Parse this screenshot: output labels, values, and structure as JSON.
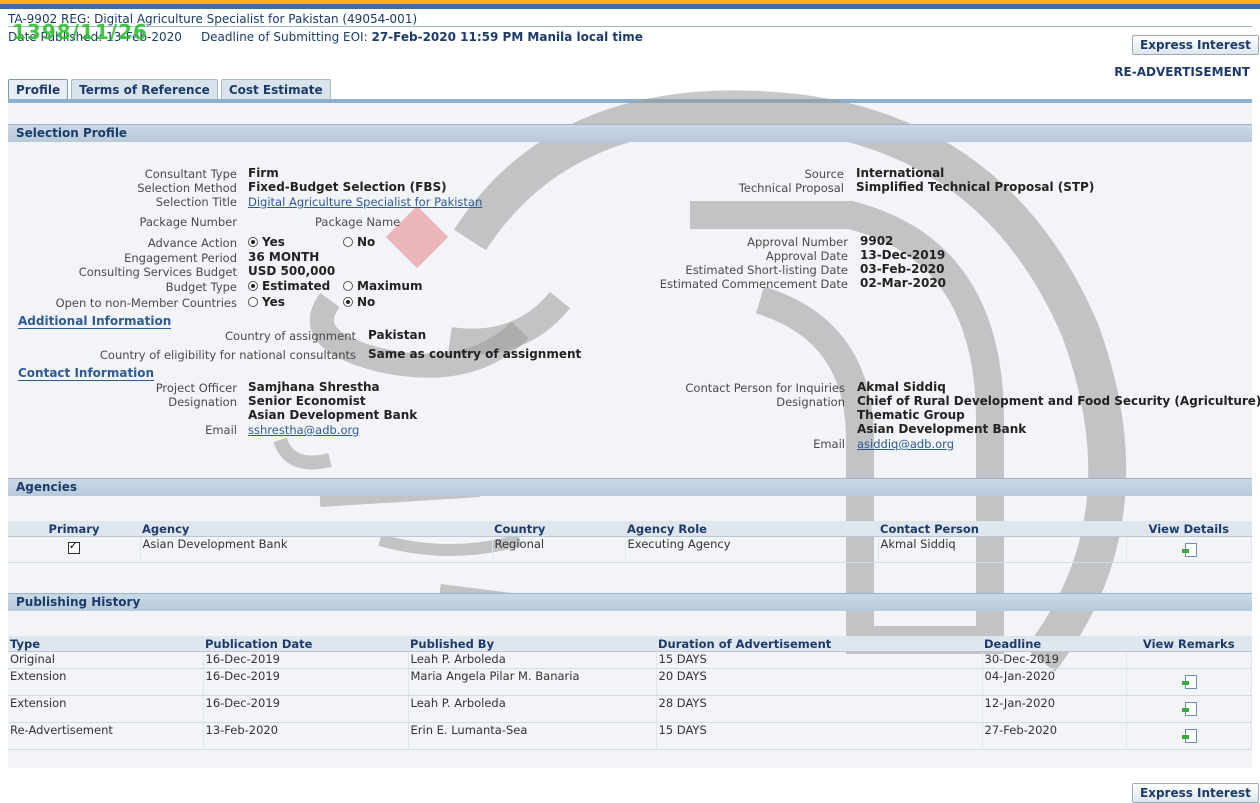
{
  "header": {
    "title": "TA-9902 REG: Digital Agriculture Specialist for Pakistan (49054-001)",
    "date_published_label": "Date Published:",
    "date_published": "13-Feb-2020",
    "deadline_label": "Deadline of Submitting EOI:",
    "deadline": "27-Feb-2020 11:59 PM Manila local time",
    "stamp": "1398/11/26",
    "express_interest": "Express Interest",
    "readvertisement": "RE-ADVERTISEMENT"
  },
  "tabs": [
    {
      "label": "Profile",
      "active": true
    },
    {
      "label": "Terms of Reference",
      "active": false
    },
    {
      "label": "Cost Estimate",
      "active": false
    }
  ],
  "selection_profile": {
    "heading": "Selection Profile",
    "consultant_type_label": "Consultant Type",
    "consultant_type": "Firm",
    "selection_method_label": "Selection Method",
    "selection_method": "Fixed-Budget Selection (FBS)",
    "selection_title_label": "Selection Title",
    "selection_title": "Digital Agriculture Specialist for Pakistan",
    "package_number_label": "Package Number",
    "package_name_label": "Package Name",
    "advance_action_label": "Advance Action",
    "yes": "Yes",
    "no": "No",
    "engagement_period_label": "Engagement Period",
    "engagement_period": "36 MONTH",
    "budget_label": "Consulting Services Budget",
    "budget": "USD 500,000",
    "budget_type_label": "Budget Type",
    "estimated": "Estimated",
    "maximum": "Maximum",
    "non_member_label": "Open to non-Member Countries",
    "source_label": "Source",
    "source": "International",
    "tech_proposal_label": "Technical Proposal",
    "tech_proposal": "Simplified Technical Proposal (STP)",
    "approval_number_label": "Approval Number",
    "approval_number": "9902",
    "approval_date_label": "Approval Date",
    "approval_date": "13-Dec-2019",
    "shortlisting_label": "Estimated Short-listing Date",
    "shortlisting": "03-Feb-2020",
    "commencement_label": "Estimated Commencement Date",
    "commencement": "02-Mar-2020",
    "additional_info": "Additional Information",
    "country_assignment_label": "Country of assignment",
    "country_assignment": "Pakistan",
    "eligibility_label": "Country of eligibility for national consultants",
    "eligibility": "Same as country of assignment",
    "contact_info": "Contact Information",
    "project_officer_label": "Project Officer",
    "project_officer": "Samjhana Shrestha",
    "designation_label": "Designation",
    "designation_1": "Senior Economist",
    "org_1": "Asian Development Bank",
    "email_label": "Email",
    "email_1": "sshrestha@adb.org",
    "contact_person_label": "Contact Person for Inquiries",
    "contact_person": "Akmal Siddiq",
    "designation_2a": "Chief of Rural Development and Food Security (Agriculture)",
    "designation_2b": "Thematic Group",
    "org_2": "Asian Development Bank",
    "email_2": "asiddiq@adb.org"
  },
  "agencies": {
    "heading": "Agencies",
    "columns": [
      "Primary",
      "Agency",
      "Country",
      "Agency Role",
      "Contact Person",
      "View Details"
    ],
    "rows": [
      {
        "agency": "Asian Development Bank",
        "country": "Regional",
        "role": "Executing Agency",
        "contact": "Akmal Siddiq"
      }
    ]
  },
  "publishing": {
    "heading": "Publishing History",
    "columns": [
      "Type",
      "Publication Date",
      "Published By",
      "Duration of Advertisement",
      "Deadline",
      "View Remarks"
    ],
    "rows": [
      {
        "type": "Original",
        "date": "16-Dec-2019",
        "by": "Leah P. Arboleda",
        "duration": "15 DAYS",
        "deadline": "30-Dec-2019"
      },
      {
        "type": "Extension",
        "date": "16-Dec-2019",
        "by": "Maria Angela Pilar M. Banaria",
        "duration": "20 DAYS",
        "deadline": "04-Jan-2020"
      },
      {
        "type": "Extension",
        "date": "16-Dec-2019",
        "by": "Leah P. Arboleda",
        "duration": "28 DAYS",
        "deadline": "12-Jan-2020"
      },
      {
        "type": "Re-Advertisement",
        "date": "13-Feb-2020",
        "by": "Erin E. Lumanta-Sea",
        "duration": "15 DAYS",
        "deadline": "27-Feb-2020"
      }
    ]
  },
  "footer": {
    "express_interest": "Express Interest"
  }
}
